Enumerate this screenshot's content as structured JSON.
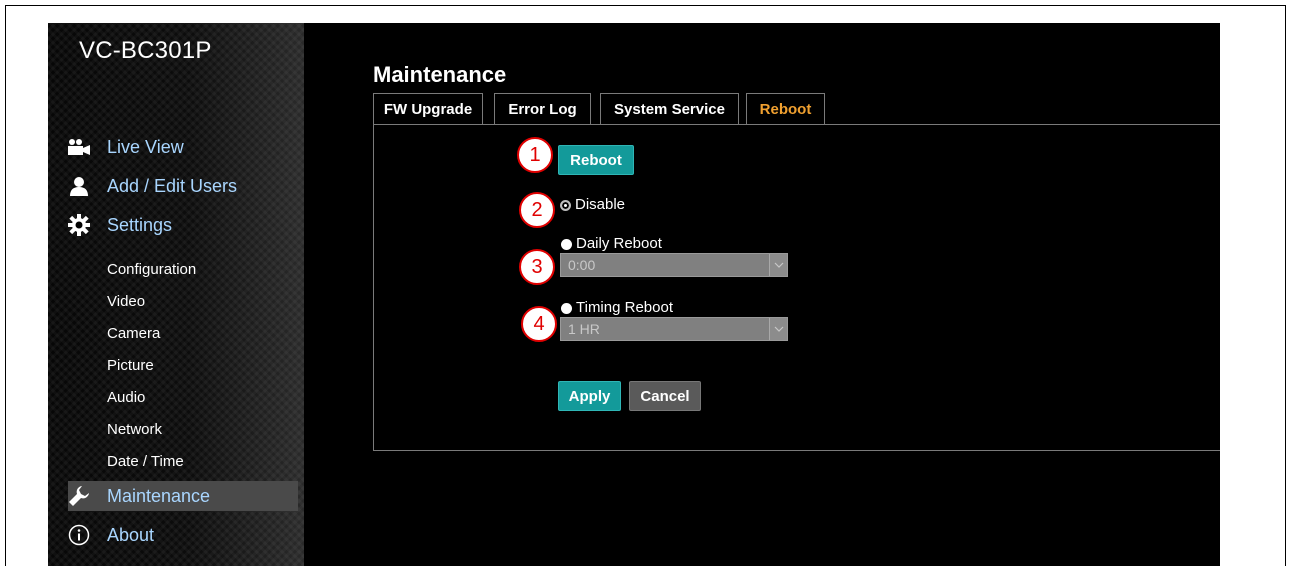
{
  "app": {
    "brand": "VC-BC301P"
  },
  "sidebar": {
    "main_items": [
      {
        "label": "Live View",
        "icon": "video-camera-icon"
      },
      {
        "label": "Add / Edit Users",
        "icon": "user-icon"
      },
      {
        "label": "Settings",
        "icon": "gear-icon"
      }
    ],
    "settings_items": [
      "Configuration",
      "Video",
      "Camera",
      "Picture",
      "Audio",
      "Network",
      "Date / Time"
    ],
    "maintenance": {
      "label": "Maintenance",
      "icon": "wrench-icon",
      "active": true
    },
    "about": {
      "label": "About",
      "icon": "info-icon"
    }
  },
  "page": {
    "title": "Maintenance"
  },
  "tabs": [
    {
      "label": "FW Upgrade",
      "active": false
    },
    {
      "label": "Error Log",
      "active": false
    },
    {
      "label": "System Service",
      "active": false
    },
    {
      "label": "Reboot",
      "active": true
    }
  ],
  "reboot": {
    "reboot_button": "Reboot",
    "options": [
      {
        "label": "Disable",
        "checked": true
      },
      {
        "label": "Daily Reboot",
        "checked": false,
        "select_value": "0:00"
      },
      {
        "label": "Timing Reboot",
        "checked": false,
        "select_value": "1 HR"
      }
    ],
    "apply_button": "Apply",
    "cancel_button": "Cancel"
  },
  "callouts": [
    "1",
    "2",
    "3",
    "4"
  ],
  "colors": {
    "accent_teal": "#139a9a",
    "active_tab": "#f0a030",
    "nav_link": "#a9d6ff",
    "callout_red": "#e00000"
  }
}
